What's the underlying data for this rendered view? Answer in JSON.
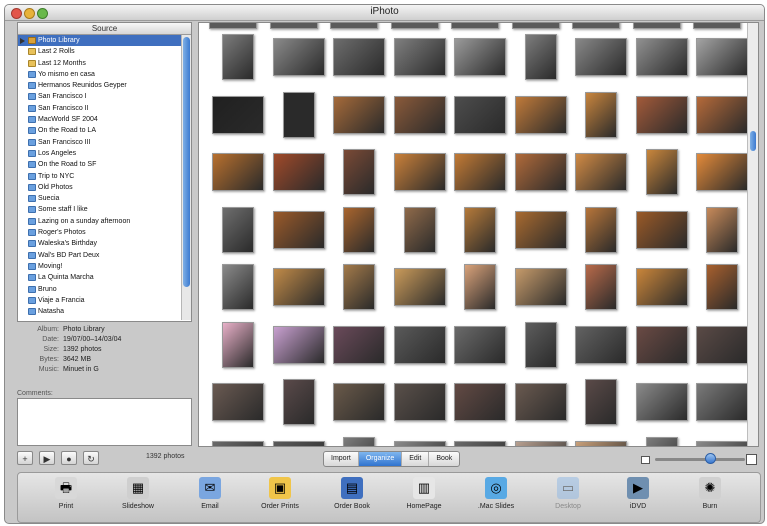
{
  "window": {
    "title": "iPhoto"
  },
  "source": {
    "header": "Source",
    "albums": [
      {
        "label": "Photo Library",
        "kind": "library",
        "selected": true
      },
      {
        "label": "Last 2 Rolls",
        "kind": "roll"
      },
      {
        "label": "Last 12 Months",
        "kind": "roll"
      },
      {
        "label": "Yo mismo en casa",
        "kind": "album"
      },
      {
        "label": "Hermanos Reunidos Geyper",
        "kind": "album"
      },
      {
        "label": "San Francisco I",
        "kind": "album"
      },
      {
        "label": "San Francisco II",
        "kind": "album"
      },
      {
        "label": "MacWorld SF 2004",
        "kind": "album"
      },
      {
        "label": "On the Road to LA",
        "kind": "album"
      },
      {
        "label": "San Francisco III",
        "kind": "album"
      },
      {
        "label": "Los Angeles",
        "kind": "album"
      },
      {
        "label": "On the Road to SF",
        "kind": "album"
      },
      {
        "label": "Trip to NYC",
        "kind": "album"
      },
      {
        "label": "Old Photos",
        "kind": "album"
      },
      {
        "label": "Suecia",
        "kind": "album"
      },
      {
        "label": "Some staff I like",
        "kind": "album"
      },
      {
        "label": "Lazing on a sunday afternoon",
        "kind": "album"
      },
      {
        "label": "Roger's Photos",
        "kind": "album"
      },
      {
        "label": "Waleska's Birthday",
        "kind": "album"
      },
      {
        "label": "Wal's BD Part Deux",
        "kind": "album"
      },
      {
        "label": "Moving!",
        "kind": "album"
      },
      {
        "label": "La Quinta Marcha",
        "kind": "album"
      },
      {
        "label": "Bruno",
        "kind": "album"
      },
      {
        "label": "Viaje a Francia",
        "kind": "album"
      },
      {
        "label": "Natasha",
        "kind": "album"
      }
    ]
  },
  "info": {
    "album_label": "Album:",
    "album_value": "Photo Library",
    "date_label": "Date:",
    "date_value": "19/07/00–14/03/04",
    "size_label": "Size:",
    "size_value": "1392 photos",
    "bytes_label": "Bytes:",
    "bytes_value": "3642 MB",
    "music_label": "Music:",
    "music_value": "Minuet in G",
    "comments_label": "Comments:"
  },
  "status": {
    "photo_count": "1392 photos",
    "add_icon": "plus-icon",
    "play_icon": "play-icon",
    "info_icon": "info-icon",
    "rotate_icon": "rotate-icon"
  },
  "modes": [
    {
      "label": "Import",
      "active": false
    },
    {
      "label": "Organize",
      "active": true
    },
    {
      "label": "Edit",
      "active": false
    },
    {
      "label": "Book",
      "active": false
    }
  ],
  "zoom": {
    "level": 0.55
  },
  "tools": [
    {
      "label": "Print",
      "icon": "printer-icon",
      "glyph": "🖶",
      "color": "#d8d8d8",
      "enabled": true
    },
    {
      "label": "Slideshow",
      "icon": "slideshow-icon",
      "glyph": "▦",
      "color": "#cfcfcf",
      "enabled": true
    },
    {
      "label": "Email",
      "icon": "email-icon",
      "glyph": "✉",
      "color": "#7aa6e0",
      "enabled": true
    },
    {
      "label": "Order Prints",
      "icon": "order-prints-icon",
      "glyph": "▣",
      "color": "#f0c54a",
      "enabled": true
    },
    {
      "label": "Order Book",
      "icon": "order-book-icon",
      "glyph": "▤",
      "color": "#3f6fbf",
      "enabled": true
    },
    {
      "label": "HomePage",
      "icon": "homepage-icon",
      "glyph": "▥",
      "color": "#e6e6e6",
      "enabled": true
    },
    {
      "label": ".Mac Slides",
      "icon": "mac-slides-icon",
      "glyph": "◎",
      "color": "#58a9e4",
      "enabled": true
    },
    {
      "label": "Desktop",
      "icon": "desktop-icon",
      "glyph": "▭",
      "color": "#8fb8e4",
      "enabled": false
    },
    {
      "label": "iDVD",
      "icon": "idvd-icon",
      "glyph": "▶",
      "color": "#6f8fb0",
      "enabled": true
    },
    {
      "label": "Burn",
      "icon": "burn-icon",
      "glyph": "✺",
      "color": "#d0d0d0",
      "enabled": true
    }
  ],
  "photo_tones": [
    "#7c7c7c",
    "#8a8a8a",
    "#6d6d6d",
    "#7f7f7f",
    "#9a9a9a",
    "#7d7d7d",
    "#888888",
    "#909090",
    "#a3a3a3",
    "#202020",
    "#2a2a2a",
    "#a56a3a",
    "#8a5a3a",
    "#4d4d4d",
    "#c07a3a",
    "#c8853e",
    "#a25a3a",
    "#b56a3a",
    "#b8702e",
    "#a04a2a",
    "#7a4a36",
    "#c9803a",
    "#c27a35",
    "#b06a3a",
    "#d08a45",
    "#c9863c",
    "#e38a3a",
    "#6e6e6e",
    "#9a5a2a",
    "#a9652e",
    "#8f6a4a",
    "#b57a3a",
    "#a86a30",
    "#b7753a",
    "#9a5a28",
    "#c78a5a",
    "#8a8a8a",
    "#c08a48",
    "#a37a4a",
    "#c99a5a",
    "#d9a27a",
    "#c59a6a",
    "#b86a4a",
    "#c9853a",
    "#a8602e",
    "#e8b0c8",
    "#c8a0d0",
    "#6a4a5a",
    "#5a5a5a",
    "#6a6a6a",
    "#5d5d5d",
    "#626262",
    "#6a4a44",
    "#5a4a46",
    "#6a5a52",
    "#5a4a4a",
    "#6a5a4a",
    "#5a504a",
    "#634a44",
    "#6a5a50",
    "#5a4a48",
    "#8a8a8a",
    "#7a7a7a",
    "#6a6a6a",
    "#5a5a5a",
    "#7d7d7d",
    "#8a8a8a",
    "#6a6a6a",
    "#b8a090",
    "#c9a07a"
  ]
}
